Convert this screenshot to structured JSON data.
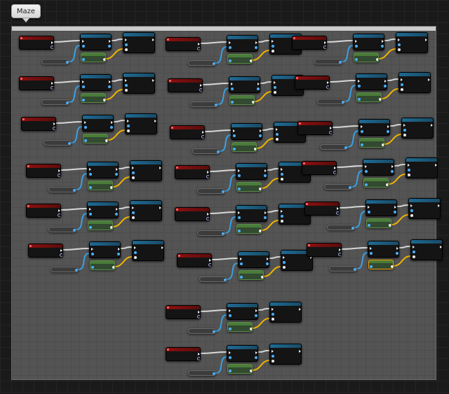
{
  "tab": {
    "label": "Maze"
  },
  "comment": {
    "label": ""
  },
  "colors": {
    "exec_wire": "#d8d8d8",
    "object_wire": "#3aa0e0",
    "vector_wire": "#f0b400",
    "event_header": "#8a1010",
    "function_header": "#1f6a93",
    "pure_header": "#4a7c3a",
    "selection": "#f0a000"
  },
  "icons": {
    "tab_pointer": "chevron-down-icon",
    "event": "event-icon",
    "function": "function-icon"
  }
}
